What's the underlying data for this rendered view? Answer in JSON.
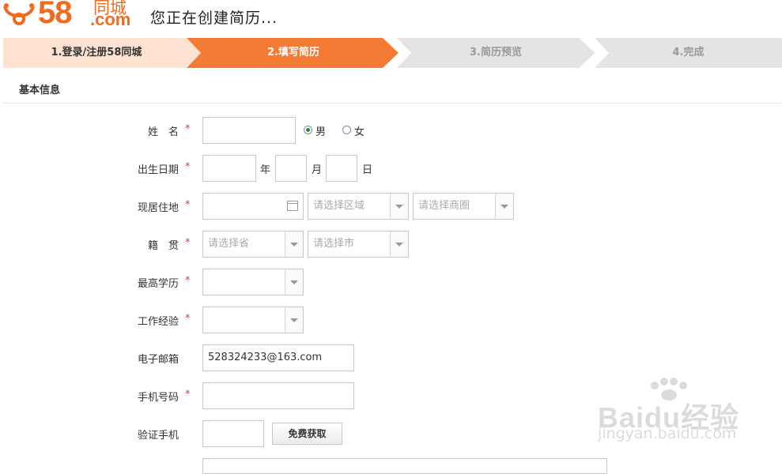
{
  "brand": {
    "logo_number": "58",
    "logo_cn": "同城",
    "logo_domain": ".com",
    "accent_color": "#f26b1d"
  },
  "header": {
    "title": "您正在创建简历..."
  },
  "steps": [
    {
      "label": "1.登录/注册58同城",
      "state": "done"
    },
    {
      "label": "2.填写简历",
      "state": "active"
    },
    {
      "label": "3.简历预览",
      "state": "pending"
    },
    {
      "label": "4.完成",
      "state": "pending"
    }
  ],
  "section": {
    "title": "基本信息"
  },
  "form": {
    "name": {
      "label": "姓　名",
      "required": "*",
      "value": ""
    },
    "gender": {
      "options": [
        "男",
        "女"
      ],
      "selected": "男"
    },
    "birthday": {
      "label": "出生日期",
      "required": "*",
      "year_unit": "年",
      "month_unit": "月",
      "day_unit": "日"
    },
    "residence": {
      "label": "现居住地",
      "required": "*",
      "area_placeholder": "请选择区域",
      "district_placeholder": "请选择商圈"
    },
    "hometown": {
      "label": "籍　贯",
      "required": "*",
      "province_placeholder": "请选择省",
      "city_placeholder": "请选择市"
    },
    "education": {
      "label": "最高学历",
      "required": "*"
    },
    "experience": {
      "label": "工作经验",
      "required": "*"
    },
    "email": {
      "label": "电子邮箱",
      "value": "528324233@163.com"
    },
    "phone": {
      "label": "手机号码",
      "required": "*"
    },
    "verify": {
      "label": "验证手机",
      "button": "免费获取"
    }
  },
  "watermark": {
    "text": "Baidu经验",
    "sub": "jingyan.baidu.com"
  }
}
